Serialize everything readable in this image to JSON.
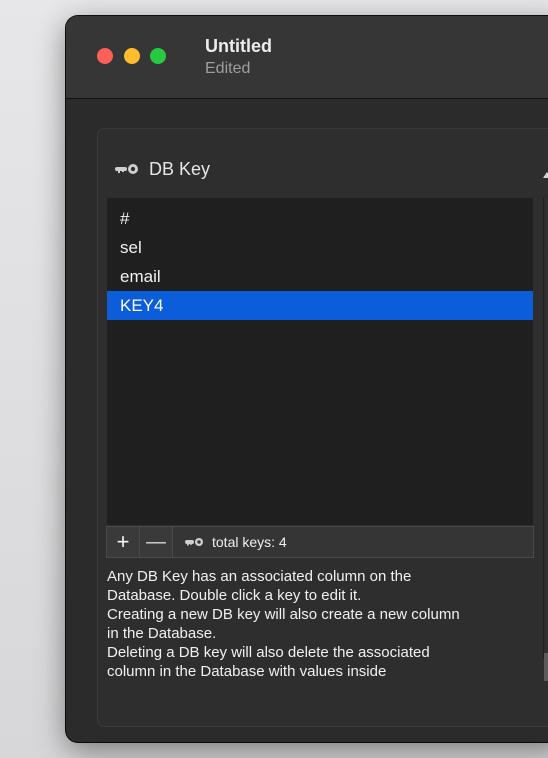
{
  "window": {
    "title": "Untitled",
    "subtitle": "Edited"
  },
  "section": {
    "icon": "key-icon",
    "title": "DB Key"
  },
  "keys": {
    "items": [
      "#",
      "sel",
      "email",
      "KEY4"
    ],
    "selected": "KEY4"
  },
  "toolbar": {
    "add_label": "+",
    "remove_label": "—",
    "status_icon": "key-icon",
    "status_text": "total keys: 4"
  },
  "help_text": {
    "lines": [
      "Any DB Key has an associated column on the",
      "Database. Double click a key to edit it.",
      "Creating a new DB key will also create a new column",
      "in the Database.",
      "Deleting a DB key will also delete the associated",
      "column in the Database with values inside"
    ]
  },
  "colors": {
    "selection": "#0b5dd9",
    "close": "#fe5f57",
    "minimize": "#febc2e",
    "zoom": "#28c840"
  }
}
